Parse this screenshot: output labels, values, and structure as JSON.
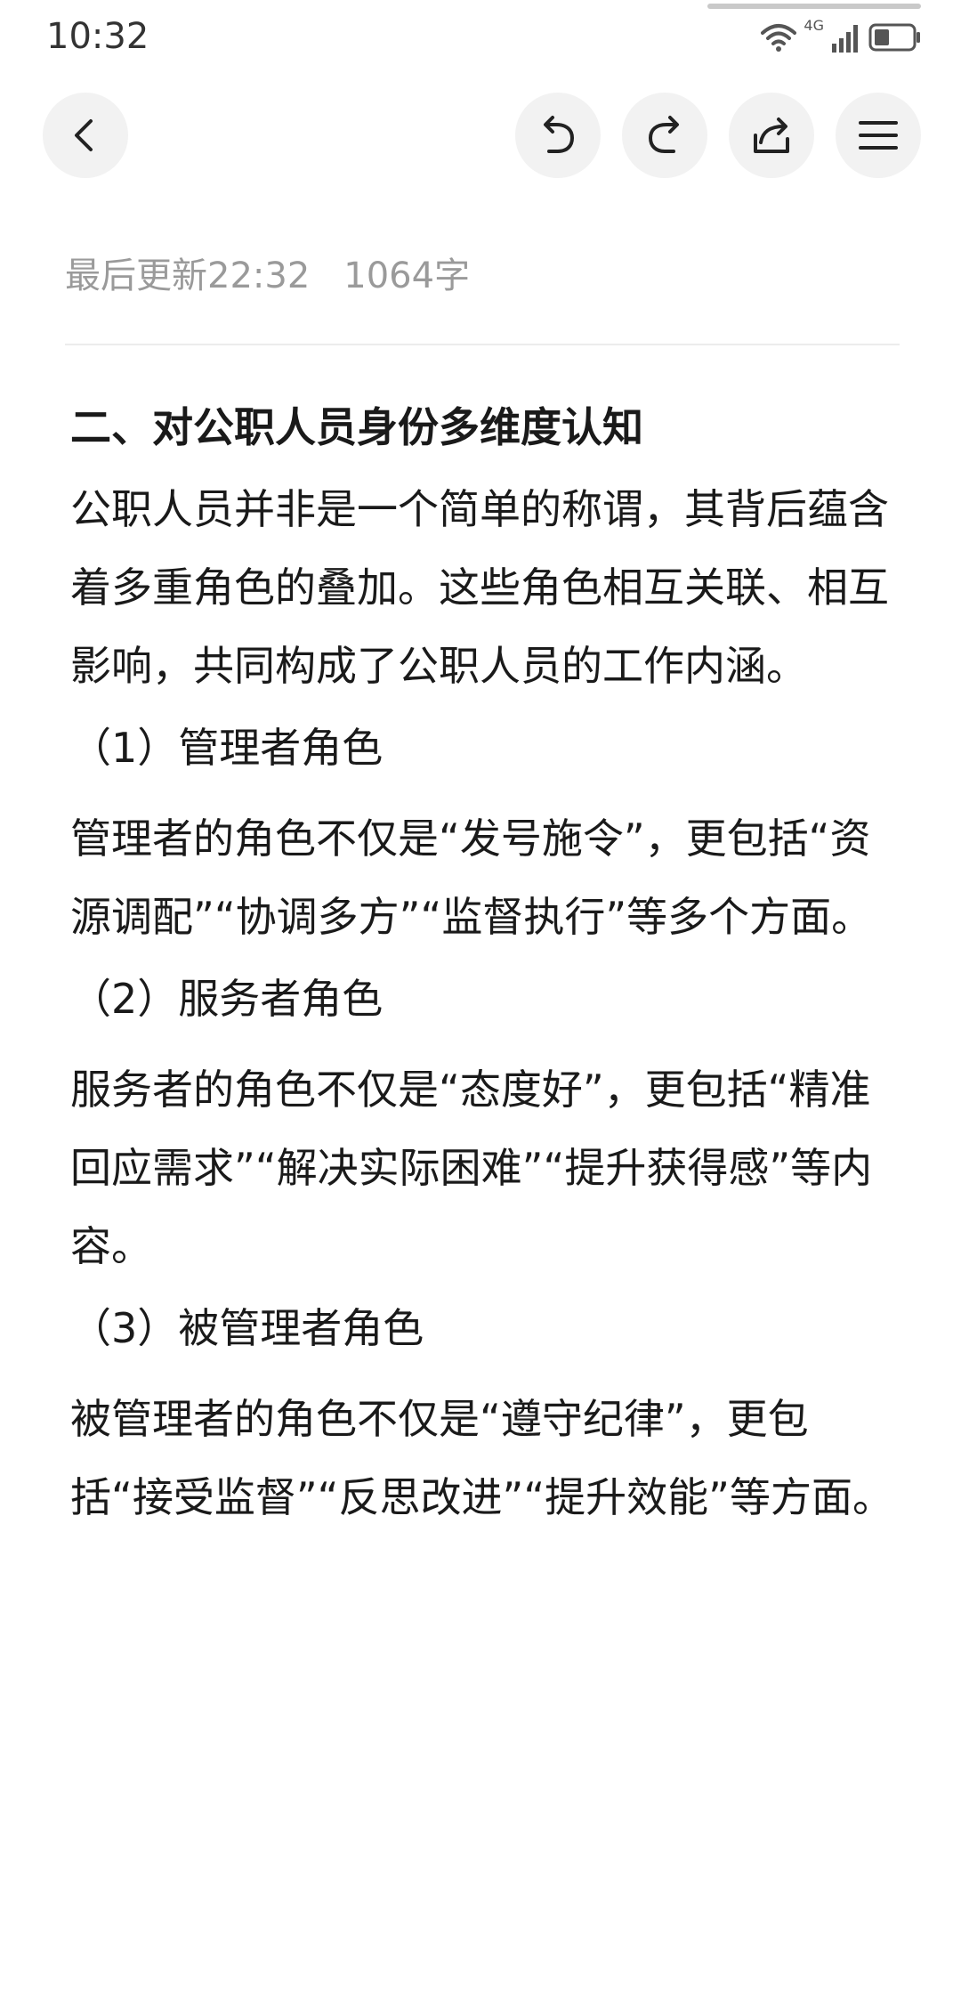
{
  "status_bar": {
    "time": "10:32",
    "network_label": "4G",
    "icons": [
      "wifi-icon",
      "cellular-signal-icon",
      "battery-icon"
    ]
  },
  "toolbar": {
    "icons": [
      "back-icon",
      "undo-icon",
      "redo-icon",
      "share-icon",
      "menu-icon"
    ]
  },
  "meta": {
    "updated": "最后更新22:32",
    "word_count": "1064字"
  },
  "document": {
    "heading": "二、对公职人员身份多维度认知",
    "intro": "公职人员并非是一个简单的称谓，其背后蕴含着多重角色的叠加。这些角色相互关联、相互影响，共同构成了公职人员的工作内涵。",
    "sections": [
      {
        "title": "（1）管理者角色",
        "body": "管理者的角色不仅是“发号施令”，更包括“资源调配”“协调多方”“监督执行”等多个方面。"
      },
      {
        "title": "（2）服务者角色",
        "body": "服务者的角色不仅是“态度好”，更包括“精准回应需求”“解决实际困难”“提升获得感”等内容。"
      },
      {
        "title": "（3）被管理者角色",
        "body": "被管理者的角色不仅是“遵守纪律”，更包括“接受监督”“反思改进”“提升效能”等方面。"
      }
    ]
  },
  "colors": {
    "text": "#1a1a1a",
    "meta_text": "#9a9a9a",
    "button_bg": "#f2f2f2",
    "divider": "#ececec"
  }
}
